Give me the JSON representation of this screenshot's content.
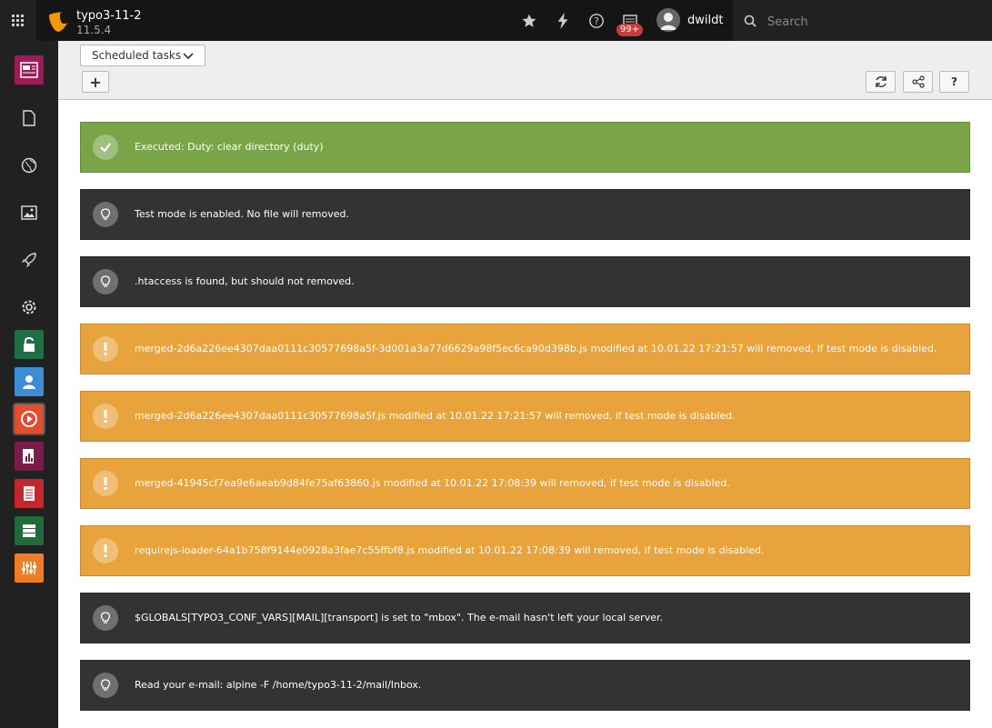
{
  "topbar": {
    "site_name": "typo3-11-2",
    "version": "11.5.4",
    "icons": [
      "apps-grid-icon",
      "star-icon",
      "bolt-icon",
      "help-icon",
      "system-info-icon"
    ],
    "notification_badge": "99+",
    "username": "dwildt",
    "search_placeholder": "Search"
  },
  "modules": [
    {
      "name": "page-module",
      "color": "#9e1b59"
    },
    {
      "name": "list-module",
      "color": "#212121"
    },
    {
      "name": "view-module",
      "color": "#212121"
    },
    {
      "name": "filelist-module",
      "color": "#212121"
    },
    {
      "name": "workspaces-module",
      "color": "#212121"
    },
    {
      "name": "settings-module",
      "color": "#212121"
    },
    {
      "name": "access-module",
      "color": "#1d7045"
    },
    {
      "name": "backend-users-module",
      "color": "#3d8dd4"
    },
    {
      "name": "scheduler-module",
      "color": "#e24c2f"
    },
    {
      "name": "reports-module",
      "color": "#7a1b4a"
    },
    {
      "name": "log-module",
      "color": "#c1272d"
    },
    {
      "name": "db-check-module",
      "color": "#1f6b3b"
    },
    {
      "name": "configuration-module",
      "color": "#f17c26"
    }
  ],
  "docheader": {
    "function_select": "Scheduled tasks",
    "add_label": "+",
    "help_label": "?"
  },
  "messages": [
    {
      "type": "ok",
      "text": "Executed: Duty: clear directory (duty)"
    },
    {
      "type": "info",
      "text": "Test mode is enabled. No file will removed."
    },
    {
      "type": "info",
      "text": ".htaccess is found, but should not removed."
    },
    {
      "type": "warn",
      "text": "merged-2d6a226ee4307daa0111c30577698a5f-3d001a3a77d6629a98f5ec6ca90d398b.js modified at 10.01.22 17:21:57 will removed, if test mode is disabled."
    },
    {
      "type": "warn",
      "text": "merged-2d6a226ee4307daa0111c30577698a5f.js modified at 10.01.22 17:21:57 will removed, if test mode is disabled."
    },
    {
      "type": "warn",
      "text": "merged-41945cf7ea9e6aeab9d84fe75af63860.js modified at 10.01.22 17:08:39 will removed, if test mode is disabled."
    },
    {
      "type": "warn",
      "text": "requirejs-loader-64a1b758f9144e0928a3fae7c55ffbf8.js modified at 10.01.22 17:08:39 will removed, if test mode is disabled."
    },
    {
      "type": "info",
      "text": "$GLOBALS[TYPO3_CONF_VARS][MAIL][transport] is set to \"mbox\". The e-mail hasn't left your local server."
    },
    {
      "type": "info",
      "text": "Read your e-mail: alpine -F /home/typo3-11-2/mail/Inbox."
    }
  ]
}
